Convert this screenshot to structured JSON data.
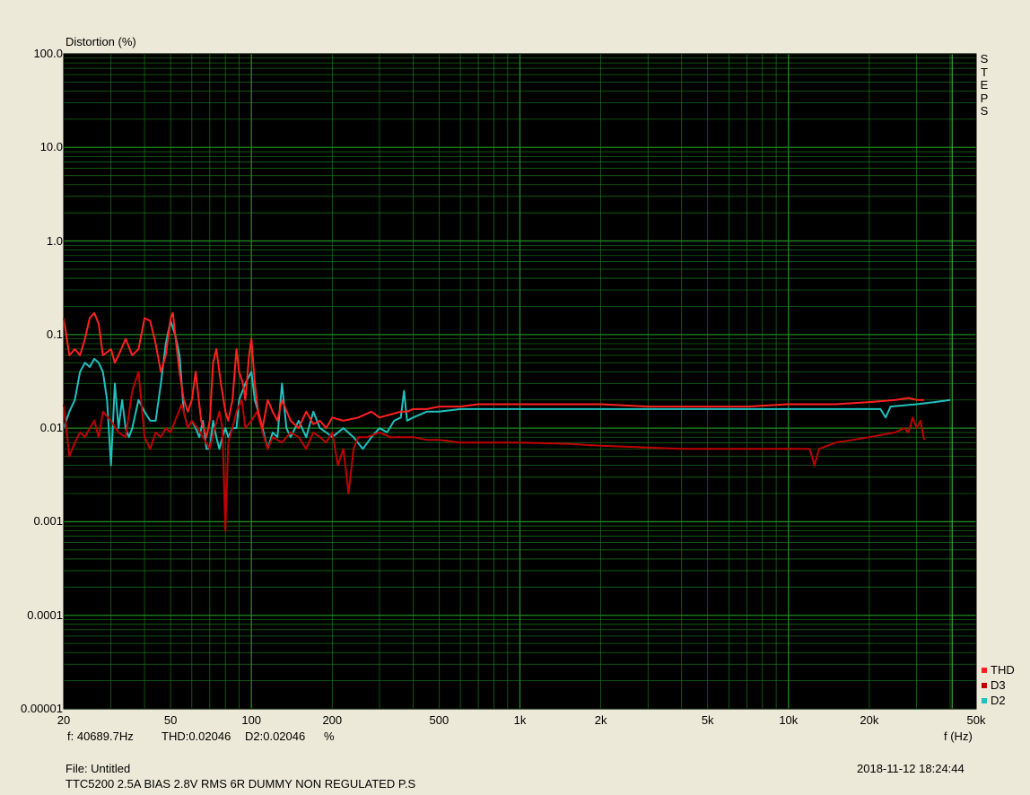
{
  "chart_data": {
    "type": "line",
    "title": "",
    "ylabel": "Distortion (%)",
    "xlabel": "f (Hz)",
    "xscale": "log",
    "yscale": "log",
    "xlim": [
      20,
      50000
    ],
    "ylim": [
      1e-05,
      100
    ],
    "grid": true,
    "legend_position": "bottom-right",
    "background": "#000000",
    "grid_color": "#1e8a1e",
    "x_ticks": [
      {
        "value": 20,
        "label": "20"
      },
      {
        "value": 50,
        "label": "50"
      },
      {
        "value": 100,
        "label": "100"
      },
      {
        "value": 200,
        "label": "200"
      },
      {
        "value": 500,
        "label": "500"
      },
      {
        "value": 1000,
        "label": "1k"
      },
      {
        "value": 2000,
        "label": "2k"
      },
      {
        "value": 5000,
        "label": "5k"
      },
      {
        "value": 10000,
        "label": "10k"
      },
      {
        "value": 20000,
        "label": "20k"
      },
      {
        "value": 50000,
        "label": "50k"
      }
    ],
    "y_ticks": [
      {
        "value": 100,
        "label": "100.0"
      },
      {
        "value": 10,
        "label": "10.0"
      },
      {
        "value": 1,
        "label": "1.0"
      },
      {
        "value": 0.1,
        "label": "0.1"
      },
      {
        "value": 0.01,
        "label": "0.01"
      },
      {
        "value": 0.001,
        "label": "0.001"
      },
      {
        "value": 0.0001,
        "label": "0.0001"
      },
      {
        "value": 1e-05,
        "label": "0.00001"
      }
    ],
    "cursor_x": 40689.7,
    "series": [
      {
        "name": "THD",
        "color": "#ff2020",
        "x": [
          20,
          21,
          22,
          23,
          24,
          25,
          26,
          27,
          28,
          30,
          31,
          32,
          34,
          36,
          38,
          40,
          42,
          44,
          46,
          48,
          50,
          51,
          52,
          54,
          56,
          58,
          60,
          62,
          65,
          68,
          70,
          72,
          74,
          77,
          80,
          82,
          85,
          88,
          90,
          93,
          95,
          98,
          100,
          103,
          106,
          110,
          115,
          120,
          125,
          130,
          140,
          150,
          160,
          170,
          180,
          190,
          200,
          220,
          250,
          280,
          300,
          330,
          360,
          380,
          400,
          450,
          500,
          600,
          700,
          800,
          1000,
          1500,
          2000,
          3000,
          5000,
          7000,
          10000,
          15000,
          20000,
          25000,
          28000,
          30000,
          32000
        ],
        "y": [
          0.15,
          0.06,
          0.07,
          0.06,
          0.09,
          0.15,
          0.17,
          0.13,
          0.06,
          0.07,
          0.05,
          0.06,
          0.09,
          0.06,
          0.07,
          0.15,
          0.14,
          0.08,
          0.04,
          0.06,
          0.15,
          0.17,
          0.1,
          0.04,
          0.02,
          0.015,
          0.02,
          0.04,
          0.012,
          0.008,
          0.012,
          0.05,
          0.07,
          0.03,
          0.015,
          0.012,
          0.02,
          0.07,
          0.04,
          0.03,
          0.02,
          0.06,
          0.09,
          0.03,
          0.015,
          0.01,
          0.02,
          0.015,
          0.012,
          0.02,
          0.012,
          0.01,
          0.015,
          0.011,
          0.012,
          0.01,
          0.013,
          0.012,
          0.013,
          0.015,
          0.013,
          0.014,
          0.015,
          0.015,
          0.016,
          0.016,
          0.017,
          0.017,
          0.018,
          0.018,
          0.018,
          0.018,
          0.018,
          0.017,
          0.017,
          0.017,
          0.018,
          0.018,
          0.019,
          0.02,
          0.021,
          0.02,
          0.02
        ]
      },
      {
        "name": "D3",
        "color": "#c00000",
        "x": [
          20,
          21,
          22,
          23,
          24,
          25,
          26,
          27,
          28,
          30,
          32,
          34,
          36,
          38,
          40,
          42,
          44,
          46,
          48,
          50,
          52,
          55,
          58,
          60,
          63,
          66,
          70,
          73,
          76,
          78,
          80,
          82,
          85,
          88,
          92,
          95,
          100,
          105,
          110,
          115,
          120,
          130,
          140,
          150,
          160,
          170,
          180,
          190,
          200,
          210,
          220,
          230,
          240,
          250,
          270,
          300,
          330,
          360,
          380,
          400,
          450,
          500,
          600,
          700,
          800,
          1000,
          1500,
          2000,
          3000,
          4000,
          5000,
          7000,
          10000,
          12000,
          12500,
          13000,
          15000,
          20000,
          25000,
          27000,
          28000,
          29000,
          30000,
          31000,
          32000
        ],
        "y": [
          0.018,
          0.005,
          0.007,
          0.009,
          0.008,
          0.01,
          0.012,
          0.008,
          0.015,
          0.012,
          0.009,
          0.008,
          0.025,
          0.04,
          0.008,
          0.006,
          0.009,
          0.008,
          0.01,
          0.009,
          0.012,
          0.018,
          0.01,
          0.012,
          0.01,
          0.008,
          0.006,
          0.01,
          0.015,
          0.01,
          0.0008,
          0.007,
          0.01,
          0.015,
          0.02,
          0.01,
          0.012,
          0.015,
          0.009,
          0.006,
          0.008,
          0.007,
          0.009,
          0.008,
          0.006,
          0.009,
          0.008,
          0.007,
          0.009,
          0.004,
          0.006,
          0.002,
          0.006,
          0.008,
          0.008,
          0.009,
          0.008,
          0.008,
          0.008,
          0.008,
          0.0075,
          0.0075,
          0.007,
          0.007,
          0.007,
          0.007,
          0.0068,
          0.0065,
          0.0062,
          0.006,
          0.006,
          0.006,
          0.006,
          0.006,
          0.004,
          0.006,
          0.007,
          0.008,
          0.009,
          0.01,
          0.009,
          0.013,
          0.01,
          0.012,
          0.0075
        ]
      },
      {
        "name": "D2",
        "color": "#20c0c0",
        "x": [
          20,
          21,
          22,
          23,
          24,
          25,
          26,
          27,
          28,
          29,
          30,
          31,
          32,
          33,
          34,
          35,
          36,
          38,
          40,
          42,
          44,
          46,
          48,
          50,
          52,
          54,
          56,
          58,
          60,
          62,
          64,
          66,
          68,
          70,
          72,
          74,
          76,
          78,
          80,
          82,
          85,
          88,
          90,
          95,
          100,
          103,
          106,
          110,
          115,
          120,
          125,
          130,
          135,
          140,
          150,
          160,
          170,
          180,
          190,
          200,
          220,
          240,
          260,
          280,
          300,
          320,
          340,
          360,
          370,
          380,
          400,
          450,
          500,
          600,
          700,
          800,
          1000,
          1500,
          2000,
          3000,
          5000,
          7000,
          10000,
          15000,
          20000,
          22000,
          23000,
          24000,
          30000,
          35000,
          40000
        ],
        "y": [
          0.01,
          0.015,
          0.02,
          0.04,
          0.05,
          0.045,
          0.055,
          0.05,
          0.04,
          0.02,
          0.004,
          0.03,
          0.01,
          0.02,
          0.01,
          0.008,
          0.01,
          0.02,
          0.015,
          0.012,
          0.012,
          0.03,
          0.08,
          0.14,
          0.1,
          0.06,
          0.015,
          0.01,
          0.012,
          0.01,
          0.008,
          0.012,
          0.006,
          0.006,
          0.012,
          0.008,
          0.006,
          0.008,
          0.01,
          0.008,
          0.01,
          0.01,
          0.02,
          0.03,
          0.04,
          0.02,
          0.015,
          0.01,
          0.006,
          0.009,
          0.008,
          0.03,
          0.01,
          0.008,
          0.012,
          0.008,
          0.015,
          0.01,
          0.009,
          0.008,
          0.01,
          0.008,
          0.006,
          0.008,
          0.01,
          0.009,
          0.012,
          0.013,
          0.025,
          0.012,
          0.013,
          0.015,
          0.015,
          0.016,
          0.016,
          0.016,
          0.016,
          0.016,
          0.016,
          0.016,
          0.016,
          0.016,
          0.016,
          0.016,
          0.016,
          0.016,
          0.013,
          0.017,
          0.018,
          0.019,
          0.02
        ]
      }
    ]
  },
  "labels": {
    "steps": [
      "S",
      "T",
      "E",
      "P",
      "S"
    ],
    "cursor_f": "f:  40689.7Hz",
    "cursor_thd": "THD:0.02046",
    "cursor_d2": "D2:0.02046",
    "cursor_unit": "%",
    "file": "File: Untitled",
    "description": "TTC5200 2.5A BIAS 2.8V RMS 6R DUMMY NON REGULATED P.S",
    "timestamp": "2018-11-12 18:24:44"
  }
}
